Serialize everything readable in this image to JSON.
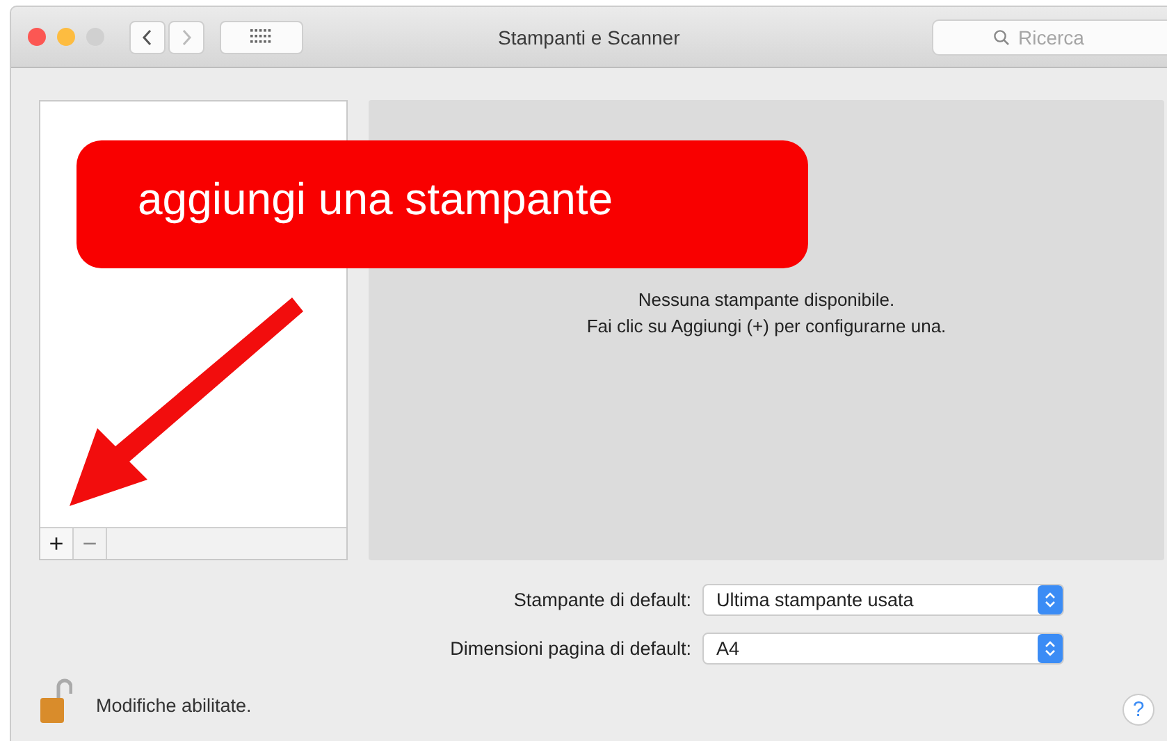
{
  "window": {
    "title": "Stampanti e Scanner"
  },
  "search": {
    "placeholder": "Ricerca"
  },
  "printer_list": {
    "buttons": [
      {
        "label": "+",
        "disabled": false
      },
      {
        "label": "−",
        "disabled": true
      }
    ]
  },
  "empty_message": [
    "Nessuna stampante disponibile.",
    "Fai clic su Aggiungi (+) per configurarne una."
  ],
  "settings": [
    {
      "label": "Stampante di default:",
      "value": "Ultima stampante usata"
    },
    {
      "label": "Dimensioni pagina di default:",
      "value": "A4"
    }
  ],
  "lock": {
    "label": "Modifiche abilitate.",
    "locked": false
  },
  "help": "?",
  "annotation": {
    "text": "aggiungi una stampante"
  }
}
